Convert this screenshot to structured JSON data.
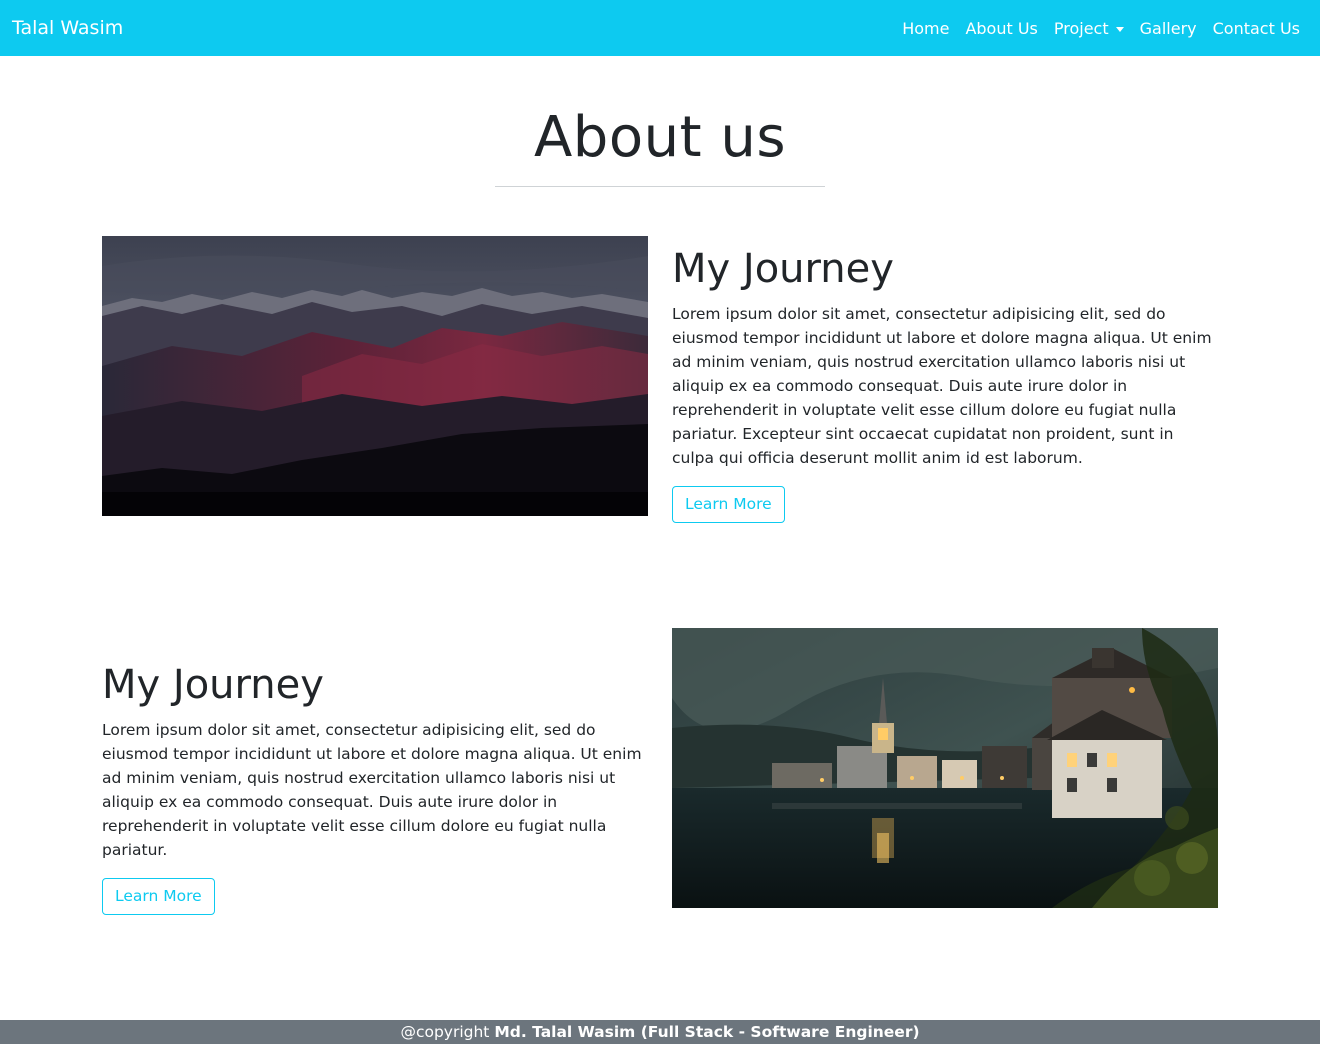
{
  "nav": {
    "brand": "Talal Wasim",
    "links": [
      "Home",
      "About Us",
      "Project",
      "Gallery",
      "Contact Us"
    ]
  },
  "page": {
    "title": "About us"
  },
  "sections": [
    {
      "heading": "My Journey",
      "body": "Lorem ipsum dolor sit amet, consectetur adipisicing elit, sed do eiusmod tempor incididunt ut labore et dolore magna aliqua. Ut enim ad minim veniam, quis nostrud exercitation ullamco laboris nisi ut aliquip ex ea commodo consequat. Duis aute irure dolor in reprehenderit in voluptate velit esse cillum dolore eu fugiat nulla pariatur. Excepteur sint occaecat cupidatat non proident, sunt in culpa qui officia deserunt mollit anim id est laborum.",
      "button": "Learn More"
    },
    {
      "heading": "My Journey",
      "body": "Lorem ipsum dolor sit amet, consectetur adipisicing elit, sed do eiusmod tempor incididunt ut labore et dolore magna aliqua. Ut enim ad minim veniam, quis nostrud exercitation ullamco laboris nisi ut aliquip ex ea commodo consequat. Duis aute irure dolor in reprehenderit in voluptate velit esse cillum dolore eu fugiat nulla pariatur.",
      "button": "Learn More"
    }
  ],
  "footer": {
    "prefix": "@copyright",
    "author": "Md. Talal Wasim (Full Stack - Software Engineer)"
  },
  "colors": {
    "navbar": "#0dcaf0",
    "accent": "#0dcaf0",
    "footer": "#6c757d",
    "text": "#212529"
  }
}
